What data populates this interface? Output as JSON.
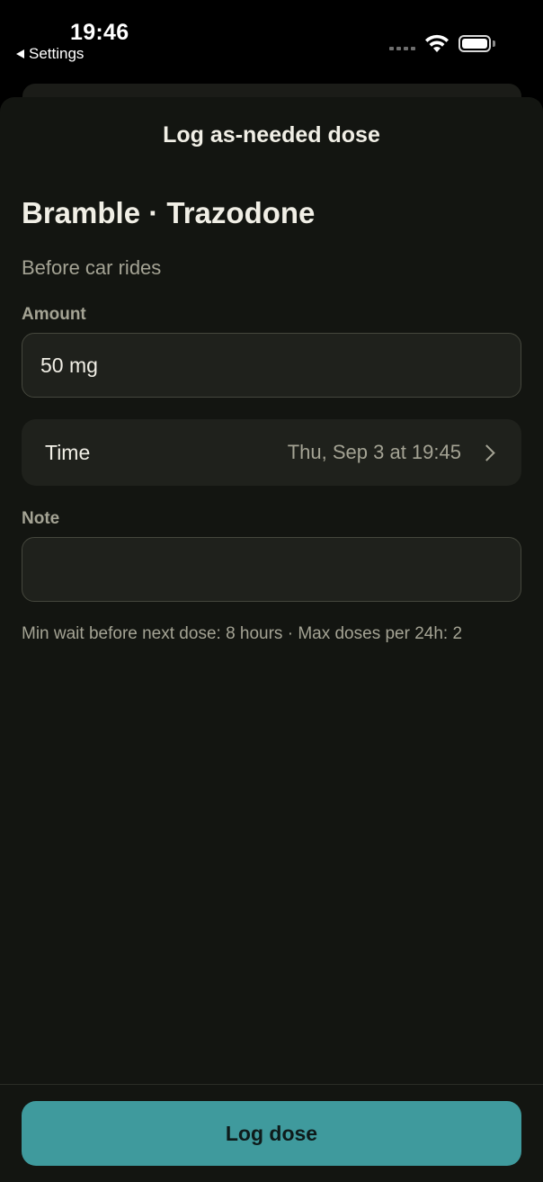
{
  "status_bar": {
    "time": "19:46",
    "back_label": "Settings"
  },
  "sheet": {
    "title": "Log as-needed dose",
    "heading": "Bramble · Trazodone",
    "subtitle": "Before car rides"
  },
  "amount": {
    "label": "Amount",
    "value": "50 mg"
  },
  "time_field": {
    "label": "Time",
    "value": "Thu, Sep 3 at 19:45"
  },
  "note": {
    "label": "Note",
    "value": ""
  },
  "limits_text": "Min wait before next dose: 8 hours · Max doses per 24h: 2",
  "primary_action": {
    "label": "Log dose"
  },
  "colors": {
    "accent": "#3f9a9d",
    "background": "#131511",
    "text_primary": "#f1efe6",
    "text_secondary": "#a4a394"
  }
}
